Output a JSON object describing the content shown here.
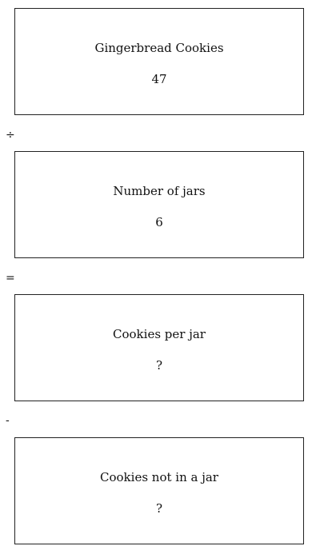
{
  "boxes": [
    {
      "label": "Gingerbread Cookies",
      "value": "47"
    },
    {
      "label": "Number of jars",
      "value": "6"
    },
    {
      "label": "Cookies per jar",
      "value": "?"
    },
    {
      "label": "Cookies not in a jar",
      "value": "?"
    }
  ],
  "operators": [
    "÷",
    "=",
    "-"
  ]
}
